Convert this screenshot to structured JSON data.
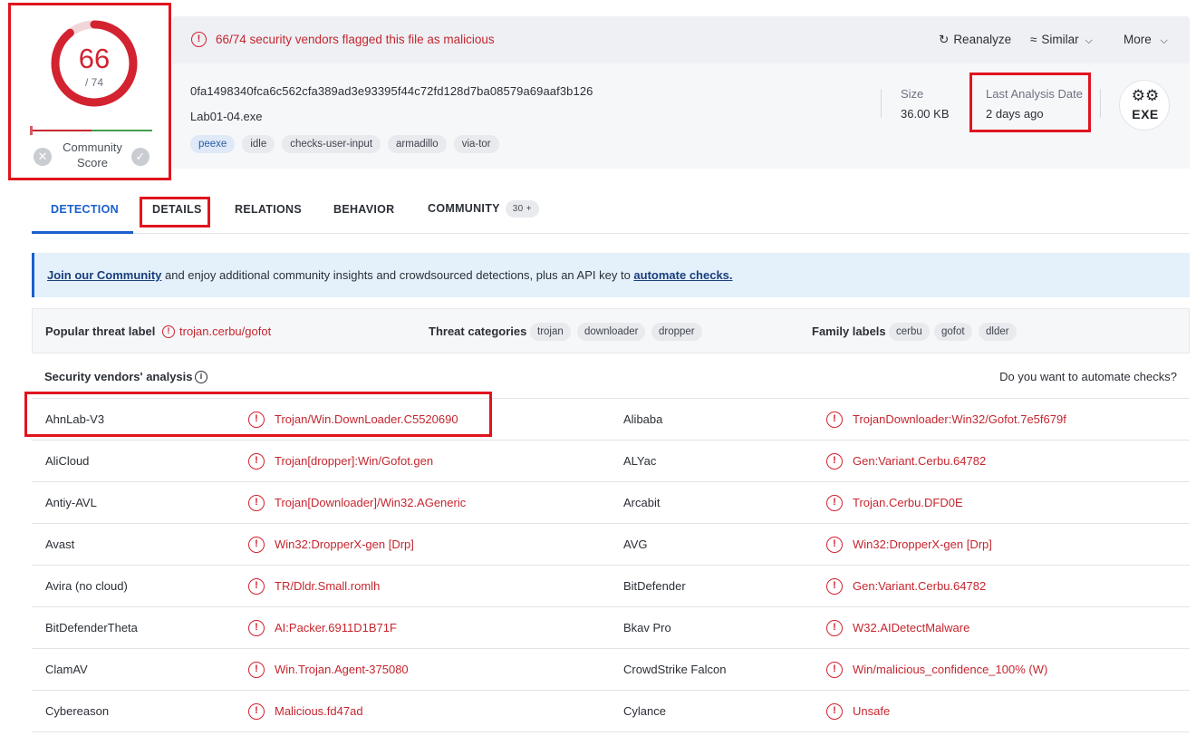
{
  "score": {
    "detections": "66",
    "total": "/ 74",
    "detection_ratio": 0.892,
    "community_label": "Community Score",
    "community_line1": "Community",
    "community_line2": "Score"
  },
  "header": {
    "alert": "66/74 security vendors flagged this file as malicious",
    "actions": {
      "reanalyze": "Reanalyze",
      "similar": "Similar",
      "more": "More"
    },
    "hash": "0fa1498340fca6c562cfa389ad3e93395f44c72fd128d7ba08579a69aaf3b126",
    "filename": "Lab01-04.exe",
    "tags": [
      "peexe",
      "idle",
      "checks-user-input",
      "armadillo",
      "via-tor"
    ],
    "size_label": "Size",
    "size_value": "36.00 KB",
    "date_label": "Last Analysis Date",
    "date_value": "2 days ago",
    "file_type": "EXE"
  },
  "tabs": {
    "detection": "DETECTION",
    "details": "DETAILS",
    "relations": "RELATIONS",
    "behavior": "BEHAVIOR",
    "community": "COMMUNITY",
    "community_count": "30 +"
  },
  "banner": {
    "link1": "Join our Community",
    "middle": " and enjoy additional community insights and crowdsourced detections, plus an API key to ",
    "link2": "automate checks."
  },
  "threat": {
    "popular_label": "Popular threat label",
    "popular_value": "trojan.cerbu/gofot",
    "categories_label": "Threat categories",
    "categories": [
      "trojan",
      "downloader",
      "dropper"
    ],
    "family_label": "Family labels",
    "families": [
      "cerbu",
      "gofot",
      "dlder"
    ]
  },
  "vendors": {
    "title": "Security vendors' analysis",
    "automate_prompt": "Do you want to automate checks?",
    "rows": [
      {
        "left_name": "AhnLab-V3",
        "left_result": "Trojan/Win.DownLoader.C5520690",
        "right_name": "Alibaba",
        "right_result": "TrojanDownloader:Win32/Gofot.7e5f679f"
      },
      {
        "left_name": "AliCloud",
        "left_result": "Trojan[dropper]:Win/Gofot.gen",
        "right_name": "ALYac",
        "right_result": "Gen:Variant.Cerbu.64782"
      },
      {
        "left_name": "Antiy-AVL",
        "left_result": "Trojan[Downloader]/Win32.AGeneric",
        "right_name": "Arcabit",
        "right_result": "Trojan.Cerbu.DFD0E"
      },
      {
        "left_name": "Avast",
        "left_result": "Win32:DropperX-gen [Drp]",
        "right_name": "AVG",
        "right_result": "Win32:DropperX-gen [Drp]"
      },
      {
        "left_name": "Avira (no cloud)",
        "left_result": "TR/Dldr.Small.romlh",
        "right_name": "BitDefender",
        "right_result": "Gen:Variant.Cerbu.64782"
      },
      {
        "left_name": "BitDefenderTheta",
        "left_result": "AI:Packer.6911D1B71F",
        "right_name": "Bkav Pro",
        "right_result": "W32.AIDetectMalware"
      },
      {
        "left_name": "ClamAV",
        "left_result": "Win.Trojan.Agent-375080",
        "right_name": "CrowdStrike Falcon",
        "right_result": "Win/malicious_confidence_100% (W)"
      },
      {
        "left_name": "Cybereason",
        "left_result": "Malicious.fd47ad",
        "right_name": "Cylance",
        "right_result": "Unsafe"
      }
    ]
  },
  "colors": {
    "malicious": "#c5262f",
    "accent": "#1a5fcc",
    "highlight_box": "#e0141e"
  },
  "icons": {
    "alert": "exclamation-circle-icon",
    "reanalyze": "refresh-icon",
    "similar": "similar-icon",
    "chevron": "chevron-down-icon",
    "info": "info-icon",
    "vote_bad": "x-circle-icon",
    "vote_good": "check-circle-icon",
    "file_type": "exe-file-icon"
  }
}
